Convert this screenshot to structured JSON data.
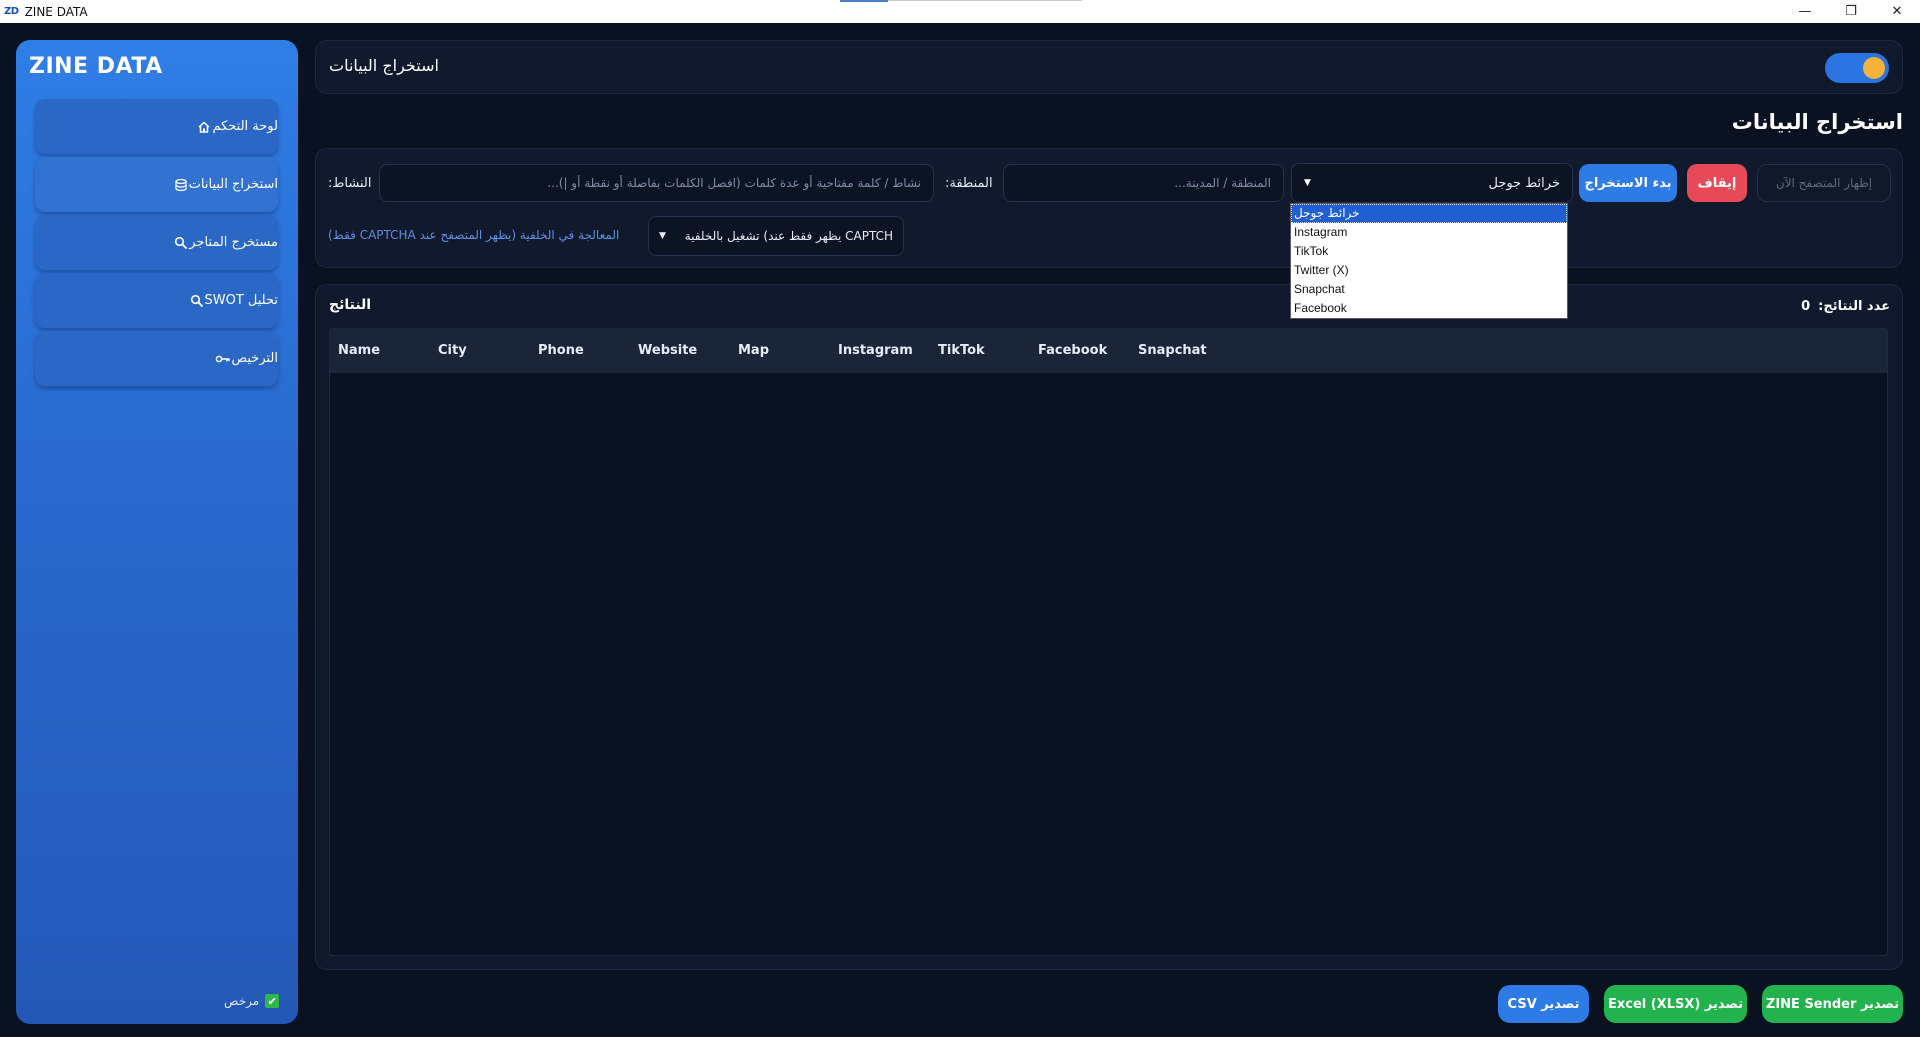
{
  "window": {
    "logo": "ZD",
    "title": "ZINE DATA",
    "controls": {
      "minimize": "—",
      "restore": "❐",
      "close": "✕"
    }
  },
  "sidebar": {
    "brand": "ZINE DATA",
    "items": [
      {
        "label": "لوحة التحكم",
        "icon": "home-icon"
      },
      {
        "label": "استخراج البيانات",
        "icon": "database-icon"
      },
      {
        "label": "مستخرج المتاجر",
        "icon": "search-icon"
      },
      {
        "label": "تحليل SWOT",
        "icon": "search-icon"
      },
      {
        "label": "الترخيص",
        "icon": "key-icon"
      }
    ],
    "licensed_label": "مرخص",
    "licensed_check": "✔"
  },
  "header": {
    "title": "استخراج البيانات",
    "theme_toggle_on": true
  },
  "page_title": "استخراج البيانات",
  "controls": {
    "activity_label": "النشاط:",
    "activity_placeholder": "نشاط / كلمة مفتاحية أو عدة كلمات (افصل الكلمات بفاصلة أو نقطة أو |)...",
    "region_label": "المنطقة:",
    "region_placeholder": "المنطقة / المدينة...",
    "source_selected": "خرائط جوجل",
    "source_options": [
      "خرائط جوجل",
      "Instagram",
      "TikTok",
      "Twitter (X)",
      "Snapchat",
      "Facebook"
    ],
    "start_button": "بدء الاستخراج",
    "stop_button": "إيقاف",
    "show_browser_button": "إظهار المتصفح الآن",
    "mode_selected": "CAPTCH يظهر فقط عند) تشغيل بالخلفية",
    "mode_note": "المعالجة في الخلفية (يظهر المتصفح عند CAPTCHA فقط)"
  },
  "results": {
    "title": "النتائج",
    "count_label": "عدد النتائج:",
    "count_value": "0",
    "columns": [
      "Name",
      "City",
      "Phone",
      "Website",
      "Map",
      "Instagram",
      "TikTok",
      "Facebook",
      "Snapchat"
    ],
    "rows": []
  },
  "export": {
    "csv": "تصدير CSV",
    "xlsx": "تصدير Excel (XLSX)",
    "sender": "تصدير ZINE Sender"
  },
  "colors": {
    "accent": "#2f7be5",
    "danger": "#e64a58",
    "success": "#22b34e",
    "background": "#0a1222",
    "panel": "#111a2c"
  }
}
